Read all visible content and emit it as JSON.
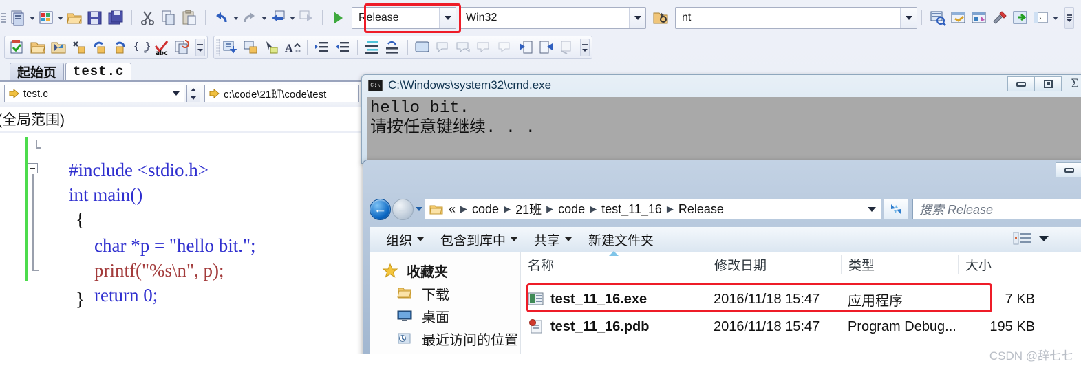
{
  "ide": {
    "toolbar_config": {
      "platform_value": "Win32",
      "config_value": "Release",
      "search_value": "nt"
    },
    "tabs": [
      {
        "label": "起始页",
        "active": false
      },
      {
        "label": "test.c",
        "active": true
      }
    ],
    "navbar": {
      "file_value": "test.c",
      "path_value": "c:\\code\\21班\\code\\test"
    },
    "scope": {
      "label": "(全局范围)"
    },
    "code": {
      "lines": [
        "#include <stdio.h>",
        "int main()",
        "{",
        "    char *p = \"hello bit.\";",
        "    printf(\"%s\\n\", p);",
        "    return 0;",
        "}"
      ]
    }
  },
  "cmd": {
    "title": "C:\\Windows\\system32\\cmd.exe",
    "icon": "console-icon",
    "output": "hello bit.\n请按任意键继续. . .",
    "buttons": [
      {
        "name": "minimize-button",
        "glyph": "minimize"
      },
      {
        "name": "restore-button",
        "glyph": "restore"
      },
      {
        "name": "close-button",
        "glyph": "Σ"
      }
    ]
  },
  "explorer": {
    "breadcrumb": {
      "overflow": "«",
      "parts": [
        "code",
        "21班",
        "code",
        "test_11_16",
        "Release"
      ]
    },
    "search_placeholder": "搜索 Release",
    "toolbar": [
      {
        "label": "组织",
        "has_menu": true
      },
      {
        "label": "包含到库中",
        "has_menu": true
      },
      {
        "label": "共享",
        "has_menu": true
      },
      {
        "label": "新建文件夹",
        "has_menu": false
      }
    ],
    "sidebar": [
      {
        "label": "收藏夹",
        "icon": "star-icon"
      },
      {
        "label": "下载",
        "icon": "folder-icon"
      },
      {
        "label": "桌面",
        "icon": "desktop-icon"
      },
      {
        "label": "最近访问的位置",
        "icon": "recent-places-icon"
      }
    ],
    "columns": [
      "名称",
      "修改日期",
      "类型",
      "大小"
    ],
    "files": [
      {
        "name": "test_11_16.exe",
        "modified": "2016/11/18 15:47",
        "type": "应用程序",
        "size": "7 KB",
        "icon": "exe-icon",
        "highlighted": true
      },
      {
        "name": "test_11_16.pdb",
        "modified": "2016/11/18 15:47",
        "type": "Program Debug...",
        "size": "195 KB",
        "icon": "pdb-icon",
        "highlighted": false
      }
    ]
  },
  "annotation": {
    "accent_color": "#ee1c28"
  },
  "watermark": {
    "text": "CSDN @辞七七"
  }
}
